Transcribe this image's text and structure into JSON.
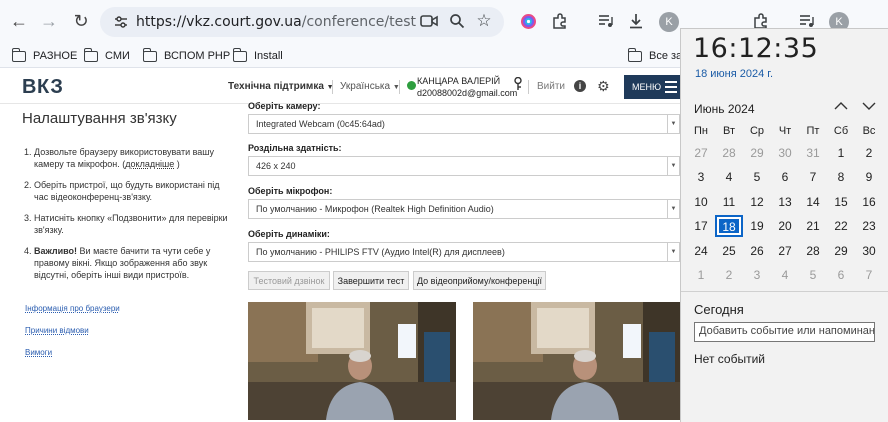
{
  "browser": {
    "url_host": "https://vkz.court.gov.ua",
    "url_path": "/conference/test",
    "profile_initial": "K",
    "bookmarks": [
      "РАЗНОЕ",
      "СМИ",
      "ВСПОМ PHP",
      "Install",
      "Все закл"
    ]
  },
  "site": {
    "logo": "ВКЗ",
    "support": "Технічна підтримка",
    "language": "Українська",
    "user_name": "КАНЦАРА ВАЛЕРІЙ",
    "user_email": "d20088002d@gmail.com",
    "logout": "Вийти",
    "menu": "МЕНЮ"
  },
  "page": {
    "title": "Налаштування зв'язку",
    "steps": [
      {
        "text": "Дозвольте браузеру використовувати вашу камеру та мікрофон. (",
        "link": "докладніше",
        "tail": " )"
      },
      {
        "text": "Оберіть пристрої, що будуть використані під час відеоконференц-зв'язку."
      },
      {
        "text": "Натисніть кнопку «Подзвонити» для перевірки зв'язку."
      },
      {
        "bold": "Важливо!",
        "text": " Ви маєте бачити та чути себе у правому вікні. Якщо зображення або звук відсутні, оберіть інші види пристроїв."
      }
    ],
    "side_links": [
      "Інформація про браузери",
      "Причини відмови",
      "Вимоги"
    ],
    "camera_label": "Оберіть камеру:",
    "camera_value": "Integrated Webcam (0c45:64ad)",
    "resolution_label": "Роздільна здатність:",
    "resolution_value": "426 x 240",
    "mic_label": "Оберіть мікрофон:",
    "mic_value": "По умолчанию - Микрофон (Realtek High Definition Audio)",
    "speaker_label": "Оберіть динаміки:",
    "speaker_value": "По умолчанию - PHILIPS FTV (Аудио Intel(R) для дисплеев)",
    "btn_test": "Тестовий дзвінок",
    "btn_end": "Завершити тест",
    "btn_goto": "До відеоприйому/конференції"
  },
  "calendar": {
    "time": "16:12:35",
    "date": "18 июня 2024 г.",
    "month": "Июнь 2024",
    "weekdays": [
      "Пн",
      "Вт",
      "Ср",
      "Чт",
      "Пт",
      "Сб",
      "Вс"
    ],
    "weeks": [
      [
        "27",
        "28",
        "29",
        "30",
        "31",
        "1",
        "2"
      ],
      [
        "3",
        "4",
        "5",
        "6",
        "7",
        "8",
        "9"
      ],
      [
        "10",
        "11",
        "12",
        "13",
        "14",
        "15",
        "16"
      ],
      [
        "17",
        "18",
        "19",
        "20",
        "21",
        "22",
        "23"
      ],
      [
        "24",
        "25",
        "26",
        "27",
        "28",
        "29",
        "30"
      ],
      [
        "1",
        "2",
        "3",
        "4",
        "5",
        "6",
        "7"
      ]
    ],
    "today_label": "Сегодня",
    "event_placeholder": "Добавить событие или напоминание",
    "no_events": "Нет событий"
  }
}
